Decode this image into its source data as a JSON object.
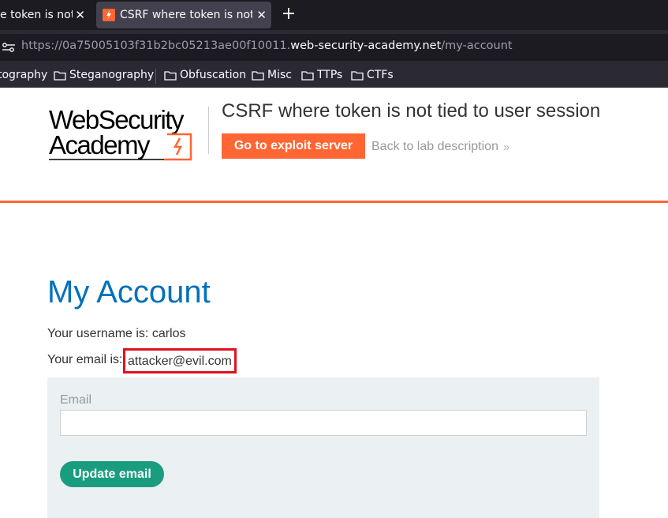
{
  "browser": {
    "tabs": [
      {
        "title": "e token is not t",
        "active": false
      },
      {
        "title": "CSRF where token is not ti",
        "active": true
      }
    ],
    "close_glyph": "✕",
    "new_tab_glyph": "+",
    "url": {
      "prefix": "https://0a75005103f31b2bc05213ae00f10011.",
      "host": "web-security-academy.net",
      "path": "/my-account"
    },
    "bookmarks": [
      {
        "label": "tography",
        "has_icon": false
      },
      {
        "label": "Steganography",
        "has_icon": true
      },
      {
        "label": "Obfuscation",
        "has_icon": true
      },
      {
        "label": "Misc",
        "has_icon": true
      },
      {
        "label": "TTPs",
        "has_icon": true
      },
      {
        "label": "CTFs",
        "has_icon": true
      }
    ]
  },
  "header": {
    "logo_line1": "WebSecurity",
    "logo_line2": "Academy",
    "lab_title": "CSRF where token is not tied to user session",
    "exploit_button": "Go to exploit server",
    "back_link": "Back to lab description",
    "back_chevrons": "»",
    "accent_color": "#ff6633"
  },
  "main": {
    "heading": "My Account",
    "username_text": "Your username is: carlos",
    "email_prefix": "Your email is:",
    "email_value": "attacker@evil.com",
    "highlight_color": "#e0121f",
    "form": {
      "email_label": "Email",
      "email_input_value": "",
      "update_button": "Update email",
      "button_color": "#1a9c7f"
    }
  }
}
